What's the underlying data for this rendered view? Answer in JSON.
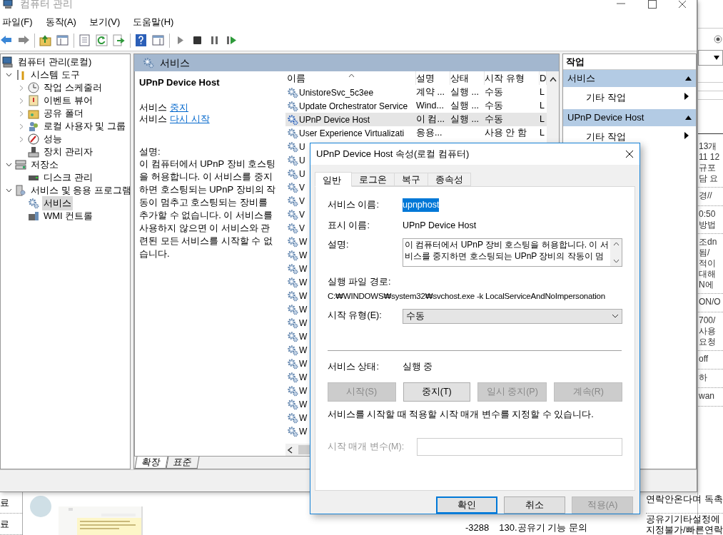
{
  "window": {
    "title": "컴퓨터 관리"
  },
  "menu": [
    "파일(F)",
    "동작(A)",
    "보기(V)",
    "도움말(H)"
  ],
  "tree": [
    {
      "label": "컴퓨터 관리(로컬)",
      "selected": false,
      "children": [
        {
          "label": "시스템 도구",
          "selected": false,
          "expanded": true,
          "children": [
            {
              "label": "작업 스케줄러",
              "selected": false,
              "expanded": false
            },
            {
              "label": "이벤트 뷰어",
              "selected": false,
              "expanded": false
            },
            {
              "label": "공유 폴더",
              "selected": false,
              "expanded": false
            },
            {
              "label": "로컬 사용자 및 그룹",
              "selected": false,
              "expanded": false
            },
            {
              "label": "성능",
              "selected": false,
              "expanded": false
            },
            {
              "label": "장치 관리자",
              "selected": false
            }
          ]
        },
        {
          "label": "저장소",
          "selected": false,
          "expanded": true,
          "children": [
            {
              "label": "디스크 관리",
              "selected": false
            }
          ]
        },
        {
          "label": "서비스 및 응용 프로그램",
          "selected": false,
          "expanded": true,
          "children": [
            {
              "label": "서비스",
              "selected": true
            },
            {
              "label": "WMI 컨트롤",
              "selected": false
            }
          ]
        }
      ]
    }
  ],
  "panel_header": "서비스",
  "detail": {
    "title": "UPnP Device Host",
    "actions": [
      {
        "prefix": "서비스",
        "link": "중지"
      },
      {
        "prefix": "서비스",
        "link": "다시 시작"
      }
    ],
    "description_label": "설명:",
    "description": "이 컴퓨터에서 UPnP 장비 호스팅을 허용합니다. 이 서비스를 중지하면 호스팅되는 UPnP 장비의 작동이 멈추고 호스팅되는 장비를 추가할 수 없습니다. 이 서비스를 사용하지 않으면 이 서비스와 관련된 모든 서비스를 시작할 수 없습니다."
  },
  "list": {
    "columns": [
      "이름",
      "설명",
      "상태",
      "시작 유형",
      "D"
    ],
    "rows": [
      {
        "name": "UnistoreSvc_5c3ee",
        "description": "계약 ...",
        "status": "실행 ...",
        "startup": "수동",
        "column_5": "L",
        "selected": false
      },
      {
        "name": "Update Orchestrator Service",
        "description": "Wind...",
        "status": "실행 ...",
        "startup": "수동",
        "column_5": "L",
        "selected": false
      },
      {
        "name": "UPnP Device Host",
        "description": "이 컴...",
        "status": "실행 ...",
        "startup": "수동",
        "column_5": "L",
        "selected": true
      },
      {
        "name": "User Experience Virtualizati",
        "description": "응용...",
        "status": "",
        "startup": "사용 안 함",
        "column_5": "L",
        "selected": false
      },
      {
        "name": "U",
        "selected": false
      },
      {
        "name": "U",
        "selected": false
      },
      {
        "name": "U",
        "selected": false
      },
      {
        "name": "V",
        "selected": false
      },
      {
        "name": "V",
        "selected": false
      },
      {
        "name": "V",
        "selected": false
      },
      {
        "name": "V",
        "selected": false
      },
      {
        "name": "W",
        "selected": false
      },
      {
        "name": "W",
        "selected": false
      },
      {
        "name": "W",
        "selected": false
      },
      {
        "name": "W",
        "selected": false
      },
      {
        "name": "W",
        "selected": false
      },
      {
        "name": "W",
        "selected": false
      },
      {
        "name": "W",
        "selected": false
      },
      {
        "name": "W",
        "selected": false
      },
      {
        "name": "W",
        "selected": false
      },
      {
        "name": "W",
        "selected": false
      },
      {
        "name": "W",
        "selected": false
      },
      {
        "name": "W",
        "selected": false
      },
      {
        "name": "W",
        "selected": false
      },
      {
        "name": "W",
        "selected": false
      },
      {
        "name": "W",
        "selected": false
      }
    ]
  },
  "view_tabs": [
    {
      "label": "확장",
      "selected": true
    },
    {
      "label": "표준",
      "selected": false
    }
  ],
  "actions_pane": {
    "title": "작업",
    "sections": [
      {
        "title": "서비스",
        "items": [
          "기타 작업"
        ]
      },
      {
        "title": "UPnP Device Host",
        "items": [
          "기타 작업"
        ]
      }
    ]
  },
  "dialog": {
    "title": "UPnP Device Host 속성(로컬 컴퓨터)",
    "tabs": [
      {
        "label": "일반",
        "selected": true
      },
      {
        "label": "로그온",
        "selected": false
      },
      {
        "label": "복구",
        "selected": false
      },
      {
        "label": "종속성",
        "selected": false
      }
    ],
    "service_name": {
      "label": "서비스 이름:",
      "value": "upnphost"
    },
    "display_name": {
      "label": "표시 이름:",
      "value": "UPnP Device Host"
    },
    "description": {
      "label": "설명:",
      "value": "이 컴퓨터에서 UPnP 장비 호스팅을 허용합니다. 이 서비스를 중지하면 호스팅되는 UPnP 장비의 작동이 멈"
    },
    "path": {
      "label": "실행 파일 경로:",
      "value": "C:₩WINDOWS₩system32₩svchost.exe -k LocalServiceAndNoImpersonation"
    },
    "startup_type": {
      "label": "시작 유형(E):",
      "value": "수동"
    },
    "service_status": {
      "label": "서비스 상태:",
      "value": "실행 중"
    },
    "control_buttons": [
      {
        "label": "시작(S)",
        "disabled": true
      },
      {
        "label": "중지(T)",
        "disabled": false
      },
      {
        "label": "일시 중지(P)",
        "disabled": true
      },
      {
        "label": "계속(R)",
        "disabled": true
      }
    ],
    "note": "서비스를 시작할 때 적용할 시작 매개 변수를 지정할 수 있습니다.",
    "start_parameters": {
      "label": "시작 매개 변수(M):",
      "disabled": true
    },
    "buttons": [
      {
        "label": "확인",
        "disabled": false
      },
      {
        "label": "취소",
        "disabled": false
      },
      {
        "label": "적용(A)",
        "disabled": true
      }
    ]
  },
  "background_window": {
    "right_groups": [
      [
        "13개",
        "11 12",
        "규포",
        "담 요"
      ],
      [
        "경//"
      ],
      [
        "0:50",
        "방법"
      ],
      [
        "조dn",
        "됨/",
        "적이",
        "대해",
        "N에"
      ],
      [
        "ON/O"
      ],
      [
        "700/",
        "사용",
        "요청"
      ],
      [
        "off"
      ],
      [
        "하"
      ],
      [
        "wan"
      ]
    ],
    "left_items": [
      "료",
      "료"
    ],
    "middle_texts": [
      "-3288",
      "130.공유기 기능 문의"
    ],
    "right_bottom": [
      "연락안온다며 독촉",
      "공유기기타설정에",
      "지정불가/빠른연락"
    ]
  }
}
